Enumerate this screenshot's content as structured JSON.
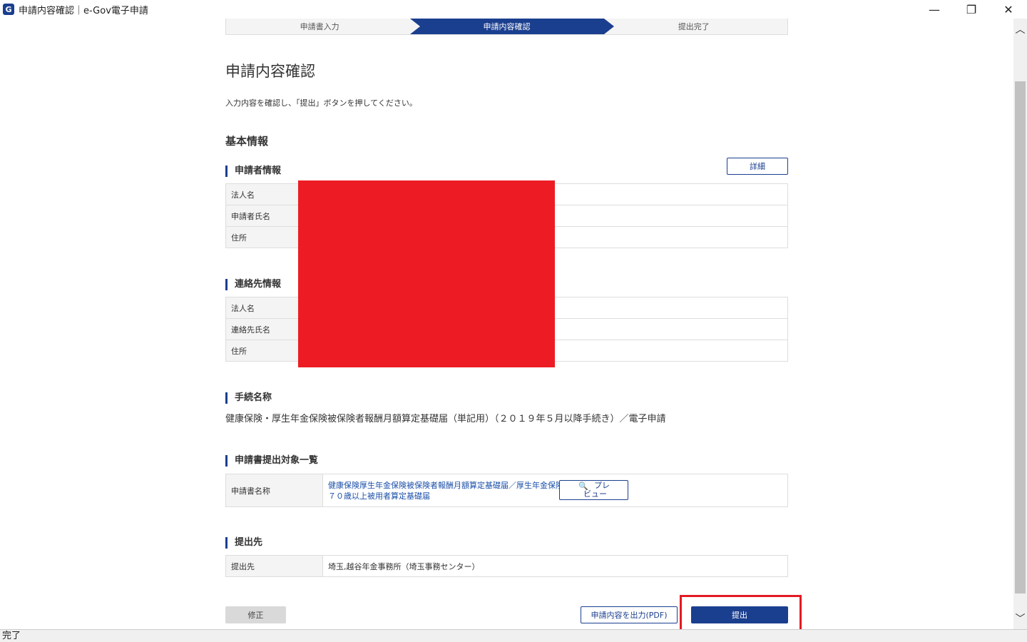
{
  "window": {
    "icon_letter": "G",
    "title": "申請内容確認｜e-Gov電子申請",
    "minimize": "—",
    "restore": "❐",
    "close": "✕"
  },
  "stepper": {
    "steps": [
      "申請書入力",
      "申請内容確認",
      "提出完了"
    ],
    "active_index": 1
  },
  "page": {
    "title": "申請内容確認",
    "lead": "入力内容を確認し、「提出」ボタンを押してください。"
  },
  "basic_info": {
    "heading": "基本情報",
    "detail_button": "詳細"
  },
  "applicant": {
    "heading": "申請者情報",
    "rows": [
      {
        "label": "法人名",
        "value": ""
      },
      {
        "label": "申請者氏名",
        "value": ""
      },
      {
        "label": "住所",
        "value": ""
      }
    ]
  },
  "contact": {
    "heading": "連絡先情報",
    "rows": [
      {
        "label": "法人名",
        "value": ""
      },
      {
        "label": "連絡先氏名",
        "value": ""
      },
      {
        "label": "住所",
        "value": ""
      }
    ]
  },
  "procedure": {
    "heading": "手続名称",
    "name": "健康保険・厚生年金保険被保険者報酬月額算定基礎届（単記用）（２０１９年５月以降手続き）／電子申請"
  },
  "documents": {
    "heading": "申請書提出対象一覧",
    "label": "申請書名称",
    "link_line1": "健康保険厚生年金保険被保険者報酬月額算定基礎届／厚生年金保険",
    "link_line2": "７０歳以上被用者算定基礎届",
    "preview_icon": "🔍",
    "preview_line1": "プレ",
    "preview_line2": "ビュー"
  },
  "destination": {
    "heading": "提出先",
    "label": "提出先",
    "value": "埼玉,越谷年金事務所（埼玉事務センター）"
  },
  "actions": {
    "fix": "修正",
    "pdf": "申請内容を出力(PDF)",
    "submit": "提出"
  },
  "status_bar": "完了",
  "colors": {
    "primary": "#1b3f8f",
    "link": "#1b4fa8",
    "highlight": "#e31b23",
    "redaction": "#ed1c24"
  }
}
